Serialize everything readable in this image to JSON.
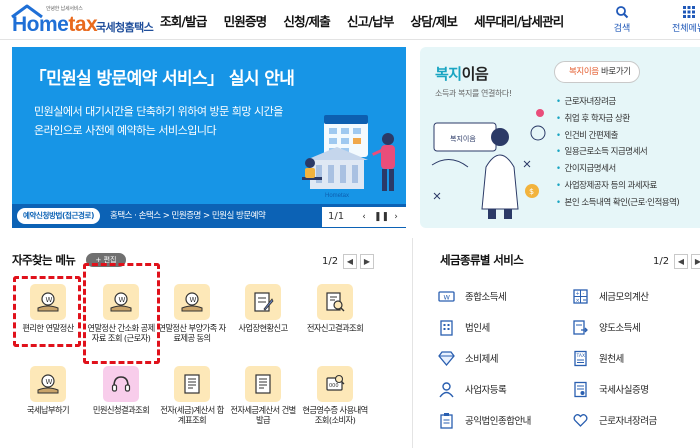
{
  "header": {
    "logo_tagline": "안녕한 납세서비스",
    "logo_brand_a": "Home",
    "logo_brand_b": "tax",
    "logo_kr": "국세청홈택스",
    "nav": [
      "조회/발급",
      "민원증명",
      "신청/제출",
      "신고/납부",
      "상담/제보",
      "세무대리/납세관리"
    ],
    "search_label": "검색",
    "allmenu_label": "전체메뉴"
  },
  "banner": {
    "title": "「민원실 방문예약 서비스」 실시 안내",
    "desc_line1": "민원실에서 대기시간을 단축하기 위하여 방문 희망 시간을",
    "desc_line2": "온라인으로 사전에 예약하는 서비스입니다",
    "route_pill": "예약신청방법(접근경로)",
    "route_path": "홈택스 · 손택스 > 민원증명 > 민원실 방문예약",
    "art_caption": "Hometax",
    "pager": "1/1",
    "bg_color": "#1795e6"
  },
  "welfare": {
    "title_a": "복지",
    "title_b": "이음",
    "subtitle": "소득과 복지를 연결하다!",
    "go_button_a": "복지이음",
    "go_button_b": " 바로가기",
    "art_card": "복지이음",
    "items": [
      "근로자녀장려금",
      "취업 후 학자금 상환",
      "인건비 간편제출",
      "일용근로소득 지급명세서",
      "간이지급명세서",
      "사업장제공자 등의 과세자료",
      "본인 소득내역 확인(근로·인적용역)"
    ]
  },
  "favorites": {
    "title": "자주찾는 메뉴",
    "edit_label": "+ 편집",
    "pager": "1/2",
    "items": [
      {
        "label": "편리한 연말정산",
        "icon": "coin-hand-icon",
        "tone": "y"
      },
      {
        "label": "연말정산 간소화 공제자료 조회 (근로자)",
        "icon": "coin-hand-icon",
        "tone": "y"
      },
      {
        "label": "연말정산 부양가족 자료제공 동의",
        "icon": "coin-hand-icon",
        "tone": "y"
      },
      {
        "label": "사업장현황신고",
        "icon": "document-pen-icon",
        "tone": "y"
      },
      {
        "label": "전자신고결과조회",
        "icon": "document-search-icon",
        "tone": "y"
      },
      {
        "label": "국세납부하기",
        "icon": "coin-hand-icon",
        "tone": "y"
      },
      {
        "label": "민원신청결과조회",
        "icon": "headset-icon",
        "tone": "p"
      },
      {
        "label": "전자(세금)계산서 합계표조회",
        "icon": "document-list-icon",
        "tone": "y"
      },
      {
        "label": "전자세금계산서 건별발급",
        "icon": "document-list-icon",
        "tone": "y"
      },
      {
        "label": "현금영수증 사용내역조회(소비자)",
        "icon": "receipt-search-icon",
        "tone": "y"
      }
    ]
  },
  "tax_services": {
    "title": "세금종류별 서비스",
    "pager": "1/2",
    "items": [
      {
        "label": "종합소득세",
        "icon": "money-icon"
      },
      {
        "label": "세금모의계산",
        "icon": "calculator-icon"
      },
      {
        "label": "법인세",
        "icon": "building-icon"
      },
      {
        "label": "양도소득세",
        "icon": "transfer-doc-icon"
      },
      {
        "label": "소비제세",
        "icon": "diamond-icon"
      },
      {
        "label": "원천세",
        "icon": "tax-doc-icon"
      },
      {
        "label": "사업자등록",
        "icon": "person-icon"
      },
      {
        "label": "국세사실증명",
        "icon": "certificate-icon"
      },
      {
        "label": "공익법인종합안내",
        "icon": "clipboard-icon"
      },
      {
        "label": "근로자녀장려금",
        "icon": "heart-hand-icon"
      }
    ]
  },
  "colors": {
    "brand_blue": "#1f6fd6",
    "brand_orange": "#e96a1e",
    "welfare_bg": "#e6f6f8",
    "highlight_red": "#e0111b"
  }
}
